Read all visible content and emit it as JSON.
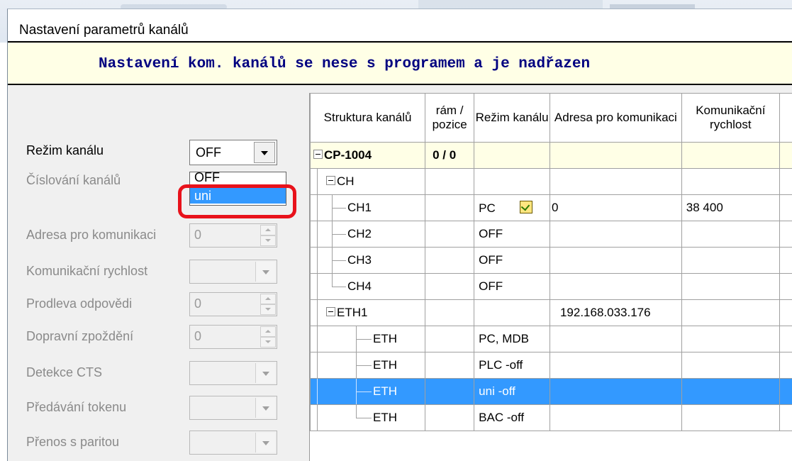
{
  "window_title": "Nastavení parametrů kanálů",
  "banner": "Nastavení kom. kanálů se nese s programem a je nadřazen",
  "form": {
    "rezim_label": "Režim kanálu",
    "rezim_value": "OFF",
    "rezim_options": [
      "OFF",
      "uni"
    ],
    "cislovani_label": "Číslování kanálů",
    "adresa_label": "Adresa pro komunikaci",
    "adresa_value": "0",
    "rychlost_label": "Komunikační rychlost",
    "prodleva_label": "Prodleva odpovědi",
    "prodleva_value": "0",
    "dopravni_label": "Dopravní zpoždění",
    "dopravni_value": "0",
    "cts_label": "Detekce CTS",
    "token_label": "Předávání tokenu",
    "parita_label": "Přenos s paritou"
  },
  "table": {
    "headers": [
      "Struktura kanálů",
      "rám / pozice",
      "Režim kanálu",
      "Adresa pro komunikaci",
      "Komunikační rychlost"
    ],
    "rows": [
      {
        "tree": "CP-1004",
        "ram": "0 / 0",
        "rezim": "",
        "adresa": "",
        "rychlost": ""
      },
      {
        "tree": "CH",
        "ram": "",
        "rezim": "",
        "adresa": "",
        "rychlost": ""
      },
      {
        "tree": "CH1",
        "ram": "",
        "rezim": "PC",
        "adresa": "0",
        "rychlost": "38 400"
      },
      {
        "tree": "CH2",
        "ram": "",
        "rezim": "OFF",
        "adresa": "",
        "rychlost": ""
      },
      {
        "tree": "CH3",
        "ram": "",
        "rezim": "OFF",
        "adresa": "",
        "rychlost": ""
      },
      {
        "tree": "CH4",
        "ram": "",
        "rezim": "OFF",
        "adresa": "",
        "rychlost": ""
      },
      {
        "tree": "ETH1",
        "ram": "",
        "rezim": "",
        "adresa": "192.168.033.176",
        "rychlost": ""
      },
      {
        "tree": "ETH",
        "ram": "",
        "rezim": "PC, MDB",
        "adresa": "",
        "rychlost": ""
      },
      {
        "tree": "ETH",
        "ram": "",
        "rezim": "PLC -off",
        "adresa": "",
        "rychlost": ""
      },
      {
        "tree": "ETH",
        "ram": "",
        "rezim": "uni -off",
        "adresa": "",
        "rychlost": ""
      },
      {
        "tree": "ETH",
        "ram": "",
        "rezim": "BAC -off",
        "adresa": "",
        "rychlost": ""
      }
    ]
  },
  "colors": {
    "selection": "#3399ff",
    "banner_bg": "#ffffe6",
    "banner_text": "#000080",
    "highlight_ring": "#e8121b"
  }
}
